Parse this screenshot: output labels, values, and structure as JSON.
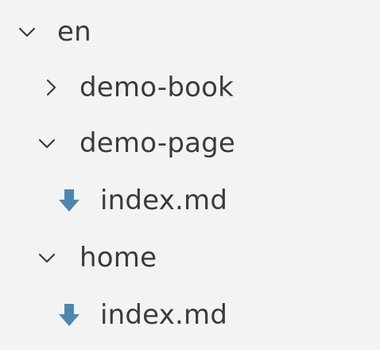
{
  "explorer": {
    "items": [
      {
        "label": "en",
        "icon": "chevron-down-icon",
        "kind": "folder",
        "expanded": true
      },
      {
        "label": "demo-book",
        "icon": "chevron-right-icon",
        "kind": "folder",
        "expanded": false
      },
      {
        "label": "demo-page",
        "icon": "chevron-down-icon",
        "kind": "folder",
        "expanded": true
      },
      {
        "label": "index.md",
        "icon": "markdown-download-icon",
        "kind": "file"
      },
      {
        "label": "home",
        "icon": "chevron-down-icon",
        "kind": "folder",
        "expanded": true
      },
      {
        "label": "index.md",
        "icon": "markdown-download-icon",
        "kind": "file"
      }
    ]
  },
  "colors": {
    "background": "#f3f3f3",
    "text": "#3b3b3b",
    "md_icon": "#4f86b0"
  }
}
